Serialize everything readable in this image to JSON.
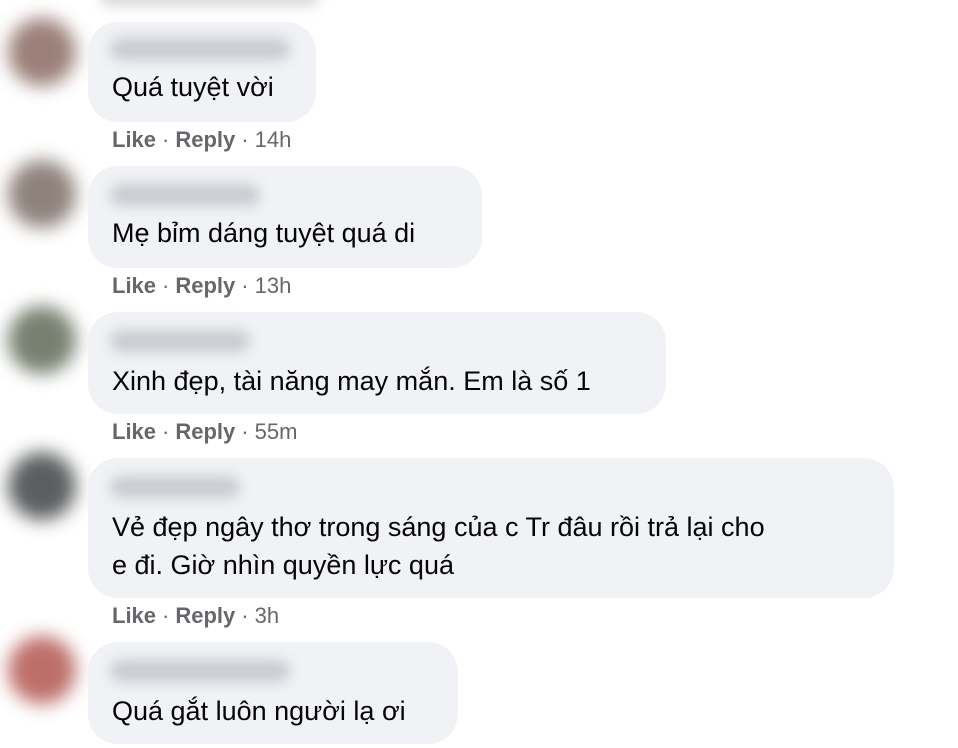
{
  "comments": [
    {
      "avatar_color": "#8a6a62",
      "text_lines": [
        "Quá tuyệt vời"
      ],
      "actions": {
        "like": "Like",
        "reply": "Reply",
        "time": "14h"
      }
    },
    {
      "avatar_color": "#7b6d66",
      "text_lines": [
        "Mẹ bỉm dáng tuyệt quá di"
      ],
      "actions": {
        "like": "Like",
        "reply": "Reply",
        "time": "13h"
      }
    },
    {
      "avatar_color": "#5f6a58",
      "text_lines": [
        "Xinh đẹp, tài năng may mắn. Em là số 1"
      ],
      "actions": {
        "like": "Like",
        "reply": "Reply",
        "time": "55m"
      }
    },
    {
      "avatar_color": "#3f4244",
      "text_lines": [
        "Vẻ đẹp ngây thơ trong sáng của c Tr đâu rồi trả lại cho",
        "e đi. Giờ nhìn quyền lực quá"
      ],
      "actions": {
        "like": "Like",
        "reply": "Reply",
        "time": "3h"
      }
    },
    {
      "avatar_color": "#b2554f",
      "text_lines": [
        "Quá gắt luôn người lạ ơi"
      ],
      "actions": null
    }
  ],
  "separator": "·",
  "colors": {
    "bubble": "#f0f2f5",
    "text": "#050505",
    "meta": "#65676b"
  }
}
